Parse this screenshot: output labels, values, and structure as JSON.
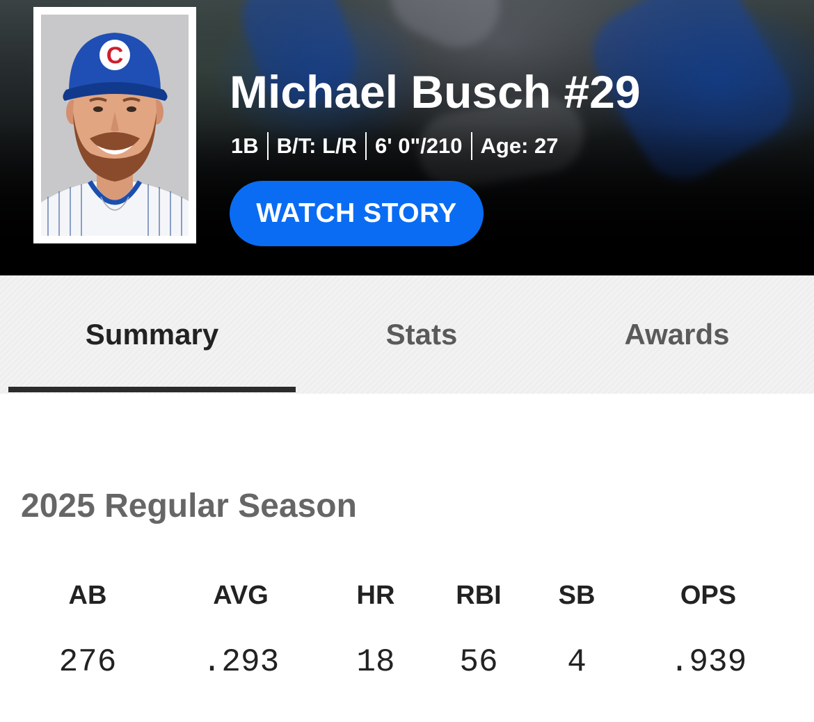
{
  "player": {
    "name": "Michael Busch #29",
    "position": "1B",
    "bats_throws": "B/T: L/R",
    "height_weight": "6' 0\"/210",
    "age": "Age: 27",
    "watch_label": "WATCH STORY",
    "team_logo_letter": "C"
  },
  "tabs": [
    {
      "label": "Summary",
      "active": true
    },
    {
      "label": "Stats",
      "active": false
    },
    {
      "label": "Awards",
      "active": false
    }
  ],
  "season": {
    "title": "2025 Regular Season",
    "stats": [
      {
        "label": "AB",
        "value": "276"
      },
      {
        "label": "AVG",
        "value": ".293"
      },
      {
        "label": "HR",
        "value": "18"
      },
      {
        "label": "RBI",
        "value": "56"
      },
      {
        "label": "SB",
        "value": "4"
      },
      {
        "label": "OPS",
        "value": ".939"
      }
    ]
  },
  "colors": {
    "accent": "#0a6cf2",
    "cubs_blue": "#1a4fb0",
    "cubs_red": "#cc1f2d"
  }
}
